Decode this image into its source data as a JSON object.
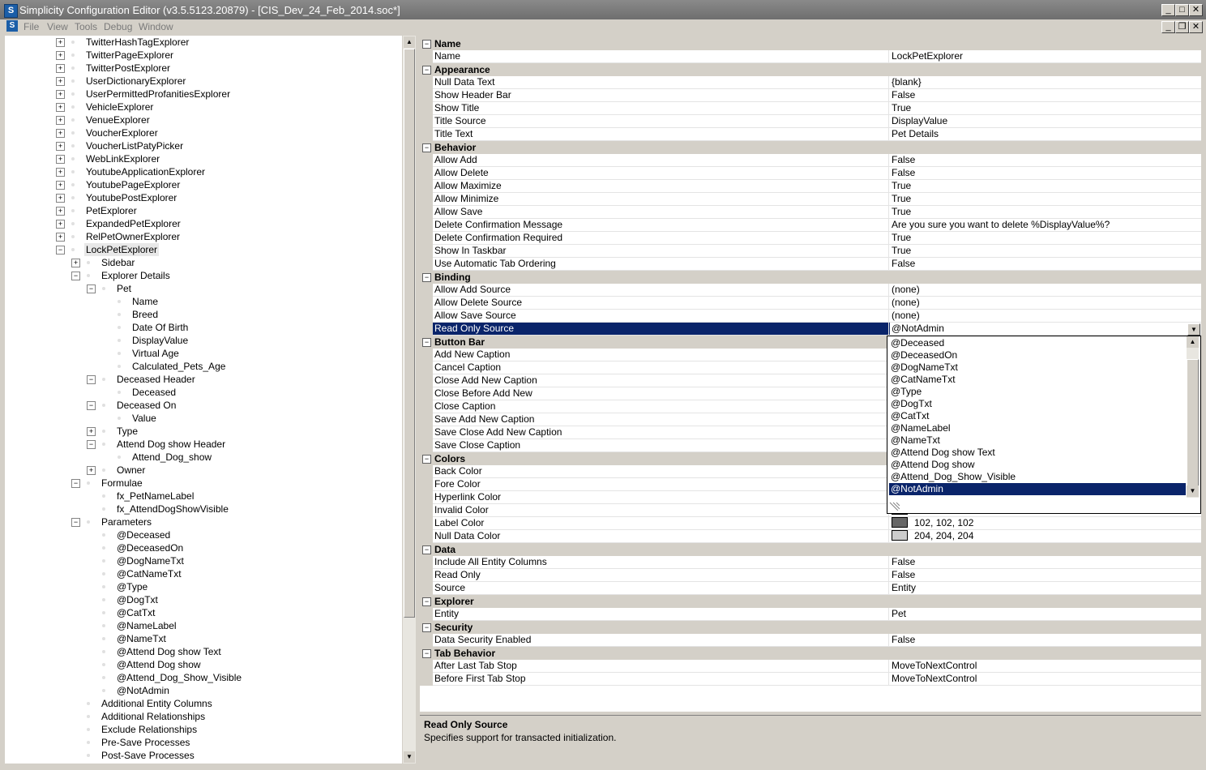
{
  "window": {
    "title": "Simplicity Configuration Editor (v3.5.5123.20879) - [CIS_Dev_24_Feb_2014.soc*]",
    "app_icon": "S",
    "controls": [
      "minimize-icon",
      "maximize-icon",
      "close-icon"
    ],
    "mdi_controls": [
      "minimize-icon",
      "restore-icon",
      "close-icon"
    ]
  },
  "menu": [
    "File",
    "View",
    "Tools",
    "Debug",
    "Window"
  ],
  "tree": [
    {
      "label": "TwitterHashTagExplorer",
      "level": 0,
      "expander": "+"
    },
    {
      "label": "TwitterPageExplorer",
      "level": 0,
      "expander": "+"
    },
    {
      "label": "TwitterPostExplorer",
      "level": 0,
      "expander": "+"
    },
    {
      "label": "UserDictionaryExplorer",
      "level": 0,
      "expander": "+"
    },
    {
      "label": "UserPermittedProfanitiesExplorer",
      "level": 0,
      "expander": "+"
    },
    {
      "label": "VehicleExplorer",
      "level": 0,
      "expander": "+"
    },
    {
      "label": "VenueExplorer",
      "level": 0,
      "expander": "+"
    },
    {
      "label": "VoucherExplorer",
      "level": 0,
      "expander": "+"
    },
    {
      "label": "VoucherListPatyPicker",
      "level": 0,
      "expander": "+"
    },
    {
      "label": "WebLinkExplorer",
      "level": 0,
      "expander": "+"
    },
    {
      "label": "YoutubeApplicationExplorer",
      "level": 0,
      "expander": "+"
    },
    {
      "label": "YoutubePageExplorer",
      "level": 0,
      "expander": "+"
    },
    {
      "label": "YoutubePostExplorer",
      "level": 0,
      "expander": "+"
    },
    {
      "label": "PetExplorer",
      "level": 0,
      "expander": "+"
    },
    {
      "label": "ExpandedPetExplorer",
      "level": 0,
      "expander": "+"
    },
    {
      "label": "RelPetOwnerExplorer",
      "level": 0,
      "expander": "+"
    },
    {
      "label": "LockPetExplorer",
      "level": 0,
      "expander": "−",
      "selected": true
    },
    {
      "label": "Sidebar",
      "level": 1,
      "expander": "+"
    },
    {
      "label": "Explorer Details",
      "level": 1,
      "expander": "−"
    },
    {
      "label": "Pet",
      "level": 2,
      "expander": "−"
    },
    {
      "label": "Name",
      "level": 3,
      "expander": ""
    },
    {
      "label": "Breed",
      "level": 3,
      "expander": ""
    },
    {
      "label": "Date Of Birth",
      "level": 3,
      "expander": ""
    },
    {
      "label": "DisplayValue",
      "level": 3,
      "expander": ""
    },
    {
      "label": "Virtual Age",
      "level": 3,
      "expander": ""
    },
    {
      "label": "Calculated_Pets_Age",
      "level": 3,
      "expander": ""
    },
    {
      "label": "Deceased Header",
      "level": 2,
      "expander": "−"
    },
    {
      "label": "Deceased",
      "level": 3,
      "expander": ""
    },
    {
      "label": "Deceased On",
      "level": 2,
      "expander": "−"
    },
    {
      "label": "Value",
      "level": 3,
      "expander": ""
    },
    {
      "label": "Type",
      "level": 2,
      "expander": "+"
    },
    {
      "label": "Attend Dog show Header",
      "level": 2,
      "expander": "−"
    },
    {
      "label": "Attend_Dog_show",
      "level": 3,
      "expander": ""
    },
    {
      "label": "Owner",
      "level": 2,
      "expander": "+"
    },
    {
      "label": "Formulae",
      "level": 1,
      "expander": "−"
    },
    {
      "label": "fx_PetNameLabel",
      "level": 2,
      "expander": ""
    },
    {
      "label": "fx_AttendDogShowVisible",
      "level": 2,
      "expander": ""
    },
    {
      "label": "Parameters",
      "level": 1,
      "expander": "−"
    },
    {
      "label": "@Deceased",
      "level": 2,
      "expander": ""
    },
    {
      "label": "@DeceasedOn",
      "level": 2,
      "expander": ""
    },
    {
      "label": "@DogNameTxt",
      "level": 2,
      "expander": ""
    },
    {
      "label": "@CatNameTxt",
      "level": 2,
      "expander": ""
    },
    {
      "label": "@Type",
      "level": 2,
      "expander": ""
    },
    {
      "label": "@DogTxt",
      "level": 2,
      "expander": ""
    },
    {
      "label": "@CatTxt",
      "level": 2,
      "expander": ""
    },
    {
      "label": "@NameLabel",
      "level": 2,
      "expander": ""
    },
    {
      "label": "@NameTxt",
      "level": 2,
      "expander": ""
    },
    {
      "label": "@Attend Dog show Text",
      "level": 2,
      "expander": ""
    },
    {
      "label": "@Attend Dog show",
      "level": 2,
      "expander": ""
    },
    {
      "label": "@Attend_Dog_Show_Visible",
      "level": 2,
      "expander": ""
    },
    {
      "label": "@NotAdmin",
      "level": 2,
      "expander": ""
    },
    {
      "label": "Additional Entity Columns",
      "level": 1,
      "expander": ""
    },
    {
      "label": "Additional Relationships",
      "level": 1,
      "expander": ""
    },
    {
      "label": "Exclude Relationships",
      "level": 1,
      "expander": ""
    },
    {
      "label": "Pre-Save Processes",
      "level": 1,
      "expander": ""
    },
    {
      "label": "Post-Save Processes",
      "level": 1,
      "expander": ""
    }
  ],
  "grid": [
    {
      "type": "cat",
      "label": "Name"
    },
    {
      "type": "prop",
      "name": "Name",
      "value": "LockPetExplorer"
    },
    {
      "type": "cat",
      "label": "Appearance"
    },
    {
      "type": "prop",
      "name": "Null Data Text",
      "value": "{blank}"
    },
    {
      "type": "prop",
      "name": "Show Header Bar",
      "value": "False"
    },
    {
      "type": "prop",
      "name": "Show Title",
      "value": "True"
    },
    {
      "type": "prop",
      "name": "Title Source",
      "value": "DisplayValue"
    },
    {
      "type": "prop",
      "name": "Title Text",
      "value": "Pet Details"
    },
    {
      "type": "cat",
      "label": "Behavior"
    },
    {
      "type": "prop",
      "name": "Allow Add",
      "value": "False"
    },
    {
      "type": "prop",
      "name": "Allow Delete",
      "value": "False"
    },
    {
      "type": "prop",
      "name": "Allow Maximize",
      "value": "True"
    },
    {
      "type": "prop",
      "name": "Allow Minimize",
      "value": "True"
    },
    {
      "type": "prop",
      "name": "Allow Save",
      "value": "True"
    },
    {
      "type": "prop",
      "name": "Delete Confirmation Message",
      "value": "Are you sure you want to delete %DisplayValue%?"
    },
    {
      "type": "prop",
      "name": "Delete Confirmation Required",
      "value": "True"
    },
    {
      "type": "prop",
      "name": "Show In Taskbar",
      "value": "True"
    },
    {
      "type": "prop",
      "name": "Use Automatic Tab Ordering",
      "value": "False"
    },
    {
      "type": "cat",
      "label": "Binding"
    },
    {
      "type": "prop",
      "name": "Allow Add Source",
      "value": "(none)"
    },
    {
      "type": "prop",
      "name": "Allow Delete Source",
      "value": "(none)"
    },
    {
      "type": "prop",
      "name": "Allow Save Source",
      "value": "(none)"
    },
    {
      "type": "prop",
      "name": "Read Only Source",
      "value": "@NotAdmin",
      "selected": true
    },
    {
      "type": "cat",
      "label": "Button Bar"
    },
    {
      "type": "prop",
      "name": "Add New Caption",
      "value": ""
    },
    {
      "type": "prop",
      "name": "Cancel Caption",
      "value": ""
    },
    {
      "type": "prop",
      "name": "Close Add New Caption",
      "value": ""
    },
    {
      "type": "prop",
      "name": "Close Before Add New",
      "value": ""
    },
    {
      "type": "prop",
      "name": "Close Caption",
      "value": ""
    },
    {
      "type": "prop",
      "name": "Save Add New Caption",
      "value": ""
    },
    {
      "type": "prop",
      "name": "Save Close Add New Caption",
      "value": ""
    },
    {
      "type": "prop",
      "name": "Save Close Caption",
      "value": ""
    },
    {
      "type": "cat",
      "label": "Colors"
    },
    {
      "type": "prop",
      "name": "Back Color",
      "value": ""
    },
    {
      "type": "prop",
      "name": "Fore Color",
      "value": ""
    },
    {
      "type": "prop",
      "name": "Hyperlink Color",
      "value": ""
    },
    {
      "type": "prop",
      "name": "Invalid Color",
      "value": "",
      "swatch": "#c0392b"
    },
    {
      "type": "prop",
      "name": "Label Color",
      "value": "102, 102, 102",
      "swatch": "#666666"
    },
    {
      "type": "prop",
      "name": "Null Data Color",
      "value": "204, 204, 204",
      "swatch": "#cccccc"
    },
    {
      "type": "cat",
      "label": "Data"
    },
    {
      "type": "prop",
      "name": "Include All Entity Columns",
      "value": "False"
    },
    {
      "type": "prop",
      "name": "Read Only",
      "value": "False"
    },
    {
      "type": "prop",
      "name": "Source",
      "value": "Entity"
    },
    {
      "type": "cat",
      "label": "Explorer"
    },
    {
      "type": "prop",
      "name": "Entity",
      "value": "Pet"
    },
    {
      "type": "cat",
      "label": "Security"
    },
    {
      "type": "prop",
      "name": "Data Security Enabled",
      "value": "False"
    },
    {
      "type": "cat",
      "label": "Tab Behavior"
    },
    {
      "type": "prop",
      "name": "After Last Tab Stop",
      "value": "MoveToNextControl"
    },
    {
      "type": "prop",
      "name": "Before First Tab Stop",
      "value": "MoveToNextControl"
    }
  ],
  "dropdown": {
    "items": [
      "@Deceased",
      "@DeceasedOn",
      "@DogNameTxt",
      "@CatNameTxt",
      "@Type",
      "@DogTxt",
      "@CatTxt",
      "@NameLabel",
      "@NameTxt",
      "@Attend Dog show Text",
      "@Attend Dog show",
      "@Attend_Dog_Show_Visible",
      "@NotAdmin"
    ],
    "selected": "@NotAdmin"
  },
  "description": {
    "title": "Read Only Source",
    "text": "Specifies support for transacted initialization."
  },
  "colors": {
    "selection": "#0a246a",
    "chrome": "#d4d0c8",
    "titlebar": "#7a7a7a"
  }
}
